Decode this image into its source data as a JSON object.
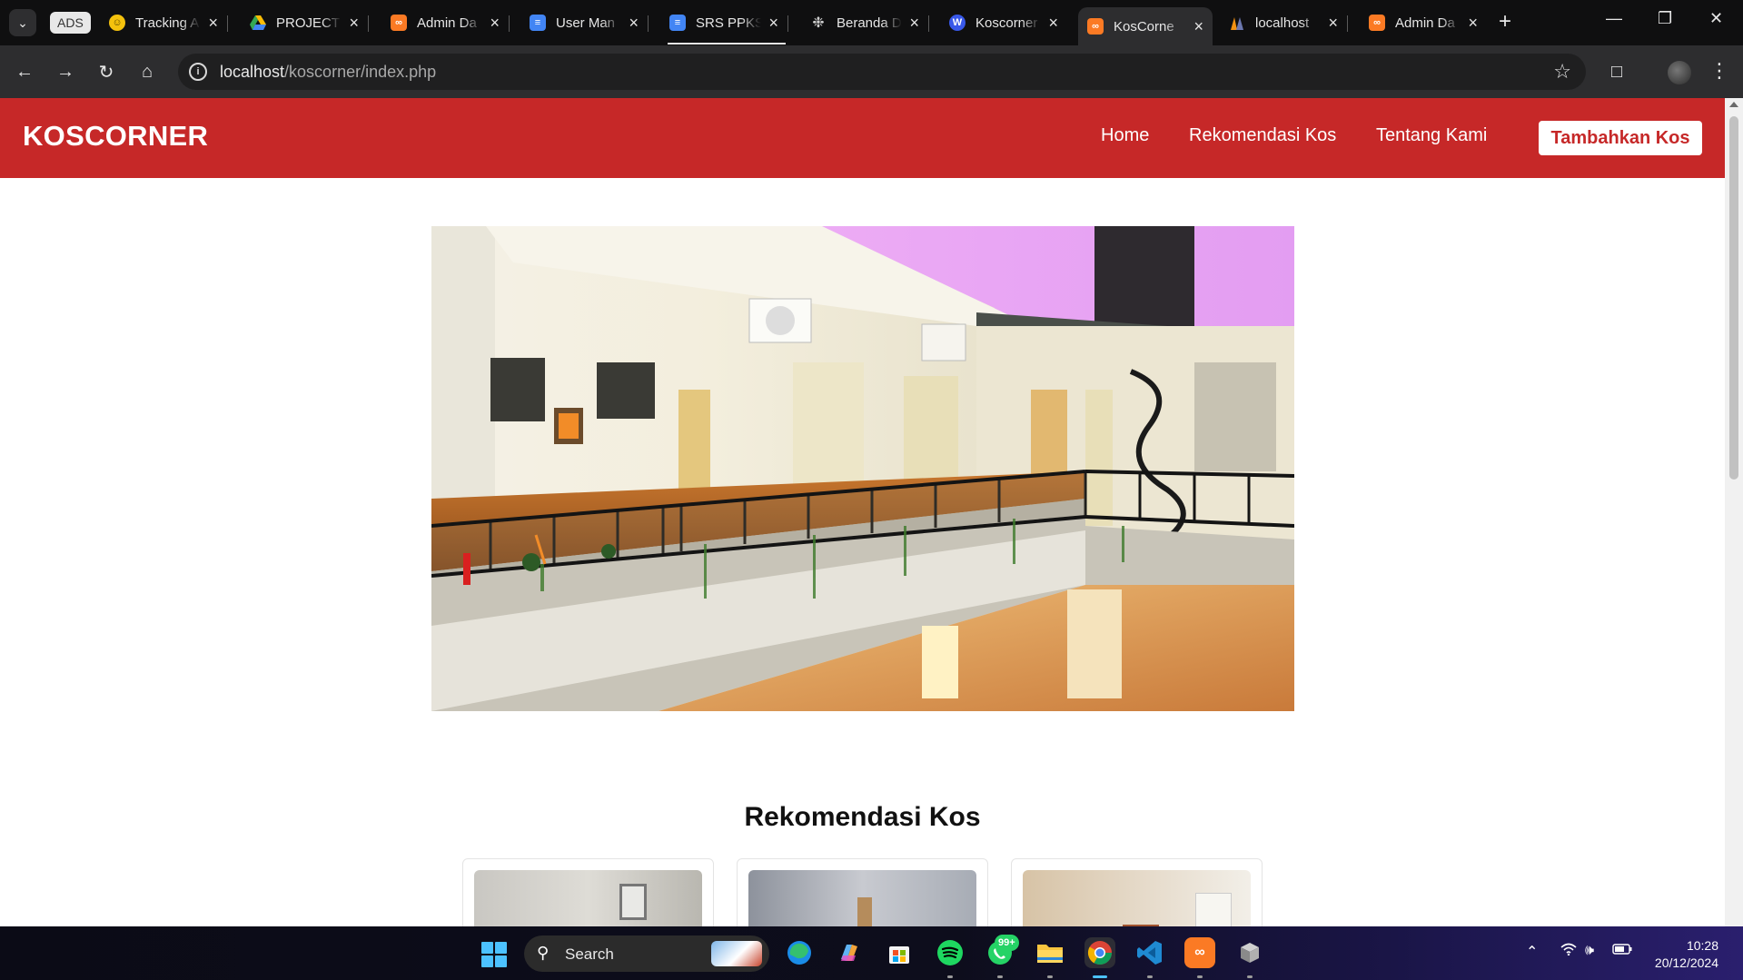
{
  "browser": {
    "ads_label": "ADS",
    "tabs": [
      {
        "title": "Tracking A",
        "favicon": "smiley-icon",
        "color": "#f4c20d"
      },
      {
        "title": "PROJECT",
        "favicon": "drive-icon",
        "color": "#34a853"
      },
      {
        "title": "Admin Da",
        "favicon": "xampp-icon",
        "color": "#fb7a24"
      },
      {
        "title": "User Man",
        "favicon": "docs-icon",
        "color": "#4285f4"
      },
      {
        "title": "SRS PPKS",
        "favicon": "docs-icon",
        "color": "#4285f4"
      },
      {
        "title": "Beranda D",
        "favicon": "openai-icon",
        "color": "#cfcfcf"
      },
      {
        "title": "Koscorner",
        "favicon": "wordpress-icon",
        "color": "#3858e9"
      },
      {
        "title": "KosCorne",
        "favicon": "xampp-icon",
        "color": "#fb7a24"
      },
      {
        "title": "localhost",
        "favicon": "phpmyadmin-icon",
        "color": "#f29111"
      },
      {
        "title": "Admin Da",
        "favicon": "xampp-icon",
        "color": "#fb7a24"
      }
    ],
    "active_tab_index": 7,
    "url_host": "localhost",
    "url_path": "/koscorner/index.php"
  },
  "site": {
    "brand": "KOSCORNER",
    "nav": {
      "home": "Home",
      "rekomendasi": "Rekomendasi Kos",
      "tentang": "Tentang Kami",
      "cta": "Tambahkan Kos"
    },
    "section_title": "Rekomendasi Kos",
    "accent": "#c62828"
  },
  "taskbar": {
    "search_label": "Search",
    "whatsapp_badge": "99+",
    "time": "10:28",
    "date": "20/12/2024"
  }
}
